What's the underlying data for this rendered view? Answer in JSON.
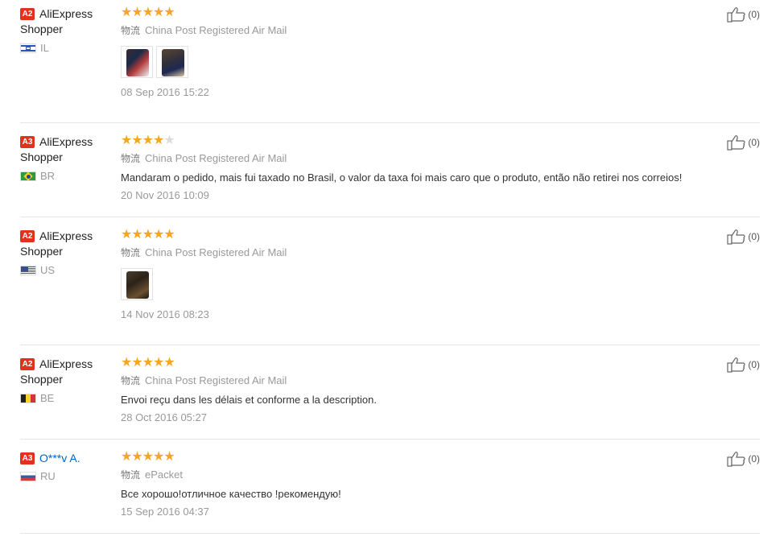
{
  "logistics_label": "物流",
  "reviews": [
    {
      "level": "A2",
      "first_name": "AliExpress",
      "last_name": "Shopper",
      "country": "IL",
      "rating": 5,
      "logistics": "China Post Registered Air Mail",
      "text": "",
      "photos": 2,
      "date": "08 Sep 2016 15:22",
      "likes": "(0)"
    },
    {
      "level": "A3",
      "first_name": "AliExpress",
      "last_name": "Shopper",
      "country": "BR",
      "rating": 4,
      "logistics": "China Post Registered Air Mail",
      "text": "Mandaram o pedido, mais fui taxado no Brasil, o valor da taxa foi mais caro que o produto, então não retirei nos correios!",
      "photos": 0,
      "date": "20 Nov 2016 10:09",
      "likes": "(0)"
    },
    {
      "level": "A2",
      "first_name": "AliExpress",
      "last_name": "Shopper",
      "country": "US",
      "rating": 5,
      "logistics": "China Post Registered Air Mail",
      "text": "",
      "photos": 1,
      "date": "14 Nov 2016 08:23",
      "likes": "(0)"
    },
    {
      "level": "A2",
      "first_name": "AliExpress",
      "last_name": "Shopper",
      "country": "BE",
      "rating": 5,
      "logistics": "China Post Registered Air Mail",
      "text": "Envoi reçu dans les délais et conforme a la description.",
      "photos": 0,
      "date": "28 Oct 2016 05:27",
      "likes": "(0)"
    },
    {
      "level": "A3",
      "first_name": "O***v A.",
      "last_name": "",
      "country": "RU",
      "rating": 5,
      "logistics": "ePacket",
      "text": "Все хорошо!отличное качество !рекомендую!",
      "photos": 0,
      "date": "15 Sep 2016 04:37",
      "likes": "(0)"
    }
  ],
  "colors": {
    "star_on": "#f5a623",
    "star_off": "#dcdcdc",
    "level_badge": "#e0321f",
    "link": "#0066c0"
  },
  "icons": {
    "like": "thumbs-up-icon",
    "star": "star-icon"
  }
}
